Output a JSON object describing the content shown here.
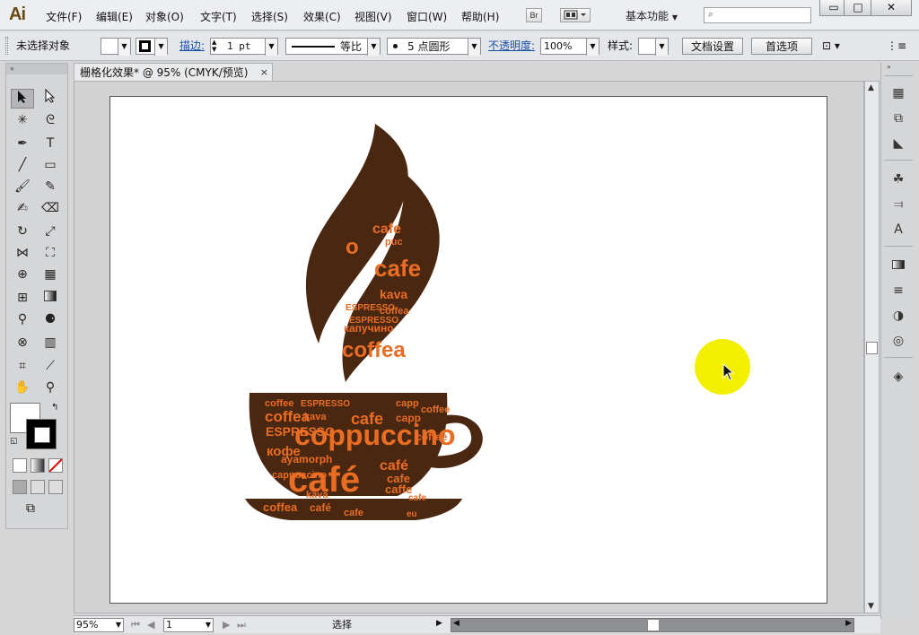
{
  "app": {
    "logo": "Ai",
    "menu": [
      "文件(F)",
      "编辑(E)",
      "对象(O)",
      "文字(T)",
      "选择(S)",
      "效果(C)",
      "视图(V)",
      "窗口(W)",
      "帮助(H)"
    ],
    "bridge_button": "Br",
    "arrange_button": "",
    "workspace": "基本功能",
    "search_placeholder": "",
    "window_buttons": [
      "▭",
      "□",
      "✕"
    ]
  },
  "control": {
    "selection_status": "未选择对象",
    "stroke_label": "描边:",
    "stroke_weight": "1 pt",
    "stroke_profile": "等比",
    "brush_definition": "5 点圆形",
    "opacity_label": "不透明度:",
    "opacity_value": "100%",
    "style_label": "样式:",
    "document_setup": "文档设置",
    "preferences": "首选项"
  },
  "document": {
    "tab_title": "栅格化效果* @ 95% (CMYK/预览)",
    "tab_close": "×"
  },
  "status": {
    "zoom": "95%",
    "page": "1",
    "label": "选择"
  },
  "artwork": {
    "cup_color": "#4a2711",
    "text_color": "#e96d23",
    "words": [
      "coffee",
      "ESPRESSO",
      "café",
      "coffea",
      "kava",
      "coppuccino",
      "cafe",
      "ESPRESSO",
      "café",
      "coffee",
      "кофе",
      "cafe",
      "cappuccino",
      "ayamorph",
      "caffe",
      "coffea",
      "kava",
      "cafe",
      "coffee",
      "capp",
      "café",
      "cafe",
      "eu",
      "puc",
      "cafe",
      "kava",
      "o",
      "ESPRESSO",
      "капучино",
      "coffea"
    ]
  },
  "tools_icons": [
    "selection-tool-icon",
    "direct-selection-tool-icon",
    "magic-wand-icon",
    "lasso-icon",
    "pen-icon",
    "type-icon",
    "line-icon",
    "rectangle-icon",
    "paintbrush-icon",
    "pencil-icon",
    "blob-brush-icon",
    "eraser-icon",
    "rotate-icon",
    "scale-icon",
    "width-icon",
    "free-transform-icon",
    "shape-builder-icon",
    "perspective-icon",
    "mesh-icon",
    "gradient-icon",
    "eyedropper-icon",
    "blend-icon",
    "symbol-sprayer-icon",
    "column-graph-icon",
    "artboard-icon",
    "slice-icon",
    "hand-icon",
    "zoom-icon"
  ]
}
